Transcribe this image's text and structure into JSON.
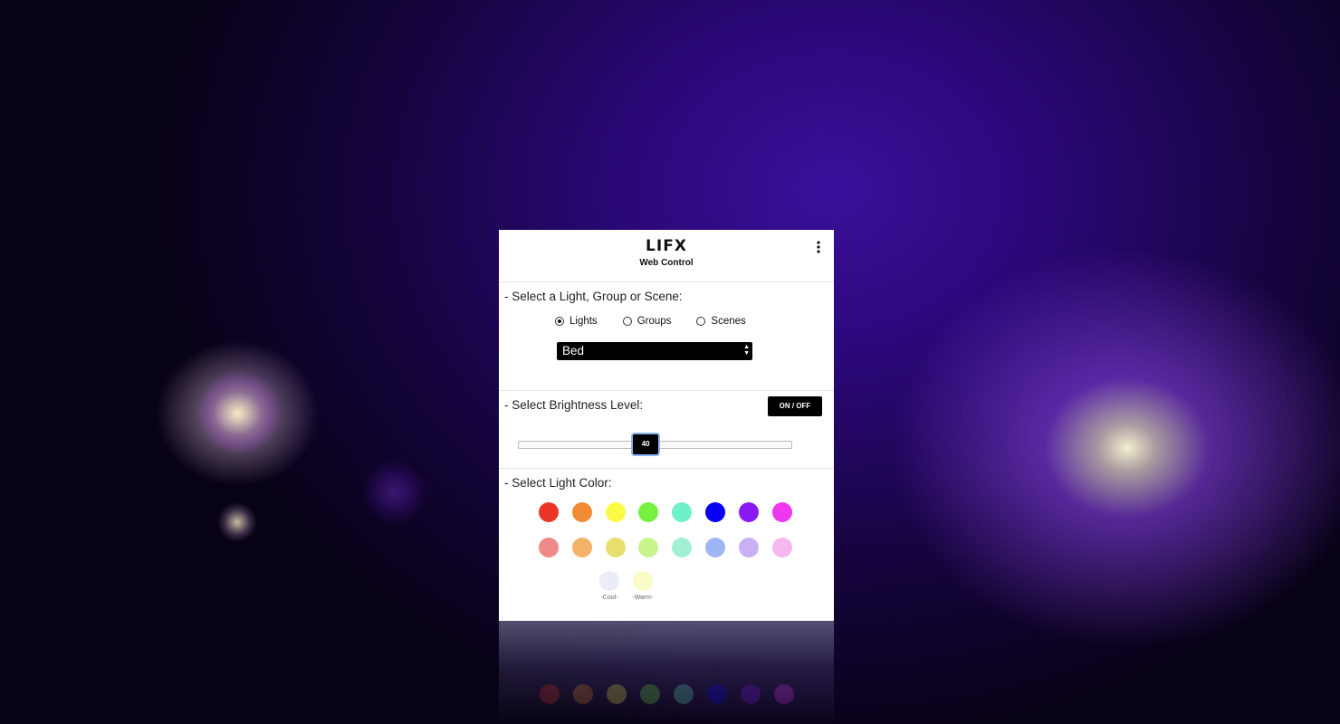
{
  "header": {
    "brand": "LIFX",
    "subtitle": "Web Control",
    "menu_icon": "vertical-dots-icon"
  },
  "select_section": {
    "title": "- Select a Light, Group or Scene:",
    "options": [
      {
        "label": "Lights",
        "checked": true
      },
      {
        "label": "Groups",
        "checked": false
      },
      {
        "label": "Scenes",
        "checked": false
      }
    ],
    "selected_value": "Bed"
  },
  "brightness_section": {
    "title": "- Select Brightness Level:",
    "toggle_label": "ON / OFF",
    "level": 40,
    "level_text": "40",
    "max": 100
  },
  "color_section": {
    "title": "- Select Light Color:",
    "vivid_colors": [
      "#ea3526",
      "#f08a33",
      "#fbfb46",
      "#76f142",
      "#6ef0c9",
      "#0a00f4",
      "#8a18f0",
      "#ee38f0"
    ],
    "pastel_colors": [
      "#ee8a87",
      "#f3b266",
      "#e8e06e",
      "#c8f48e",
      "#a1f0d2",
      "#9fb6f6",
      "#c9b0f5",
      "#f4b8ee"
    ],
    "whites": [
      {
        "label": "-Cool-",
        "color": "#eaedf8"
      },
      {
        "label": "-Warm-",
        "color": "#fbfbc7"
      }
    ]
  }
}
